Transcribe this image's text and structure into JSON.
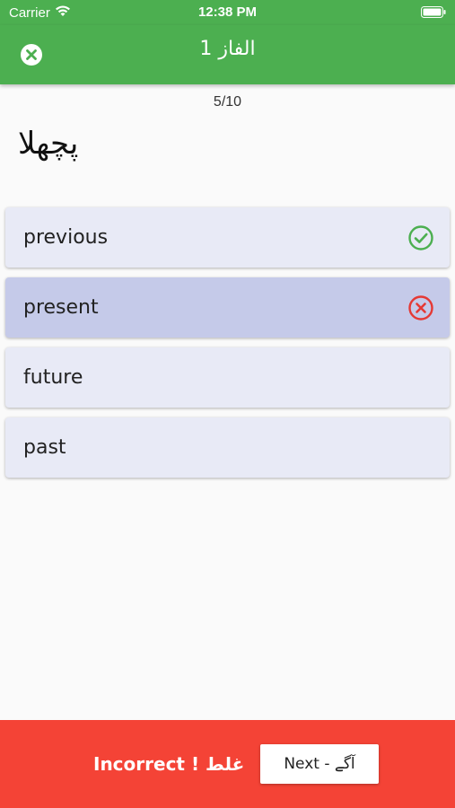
{
  "status_bar": {
    "carrier": "Carrier",
    "time": "12:38 PM",
    "icons": [
      "wifi-icon",
      "battery-icon"
    ]
  },
  "app_bar": {
    "title": "الفاز 1",
    "close_icon": "close-circle-icon"
  },
  "progress": "5/10",
  "question": {
    "word": "پچھلا"
  },
  "options": [
    {
      "label": "previous",
      "state": "correct",
      "icon": "check-circle-icon"
    },
    {
      "label": "present",
      "state": "incorrect-selected",
      "icon": "x-circle-icon"
    },
    {
      "label": "future",
      "state": "neutral"
    },
    {
      "label": "past",
      "state": "neutral"
    }
  ],
  "footer": {
    "result": "Incorrect ! غلط",
    "next_label": "Next  -  آگے"
  },
  "colors": {
    "app_bar": "#4caf50",
    "footer": "#f44336",
    "option_bg": "#e8eaf6",
    "option_selected_bg": "#c5cae9",
    "correct": "#4caf50",
    "incorrect": "#e53935"
  }
}
